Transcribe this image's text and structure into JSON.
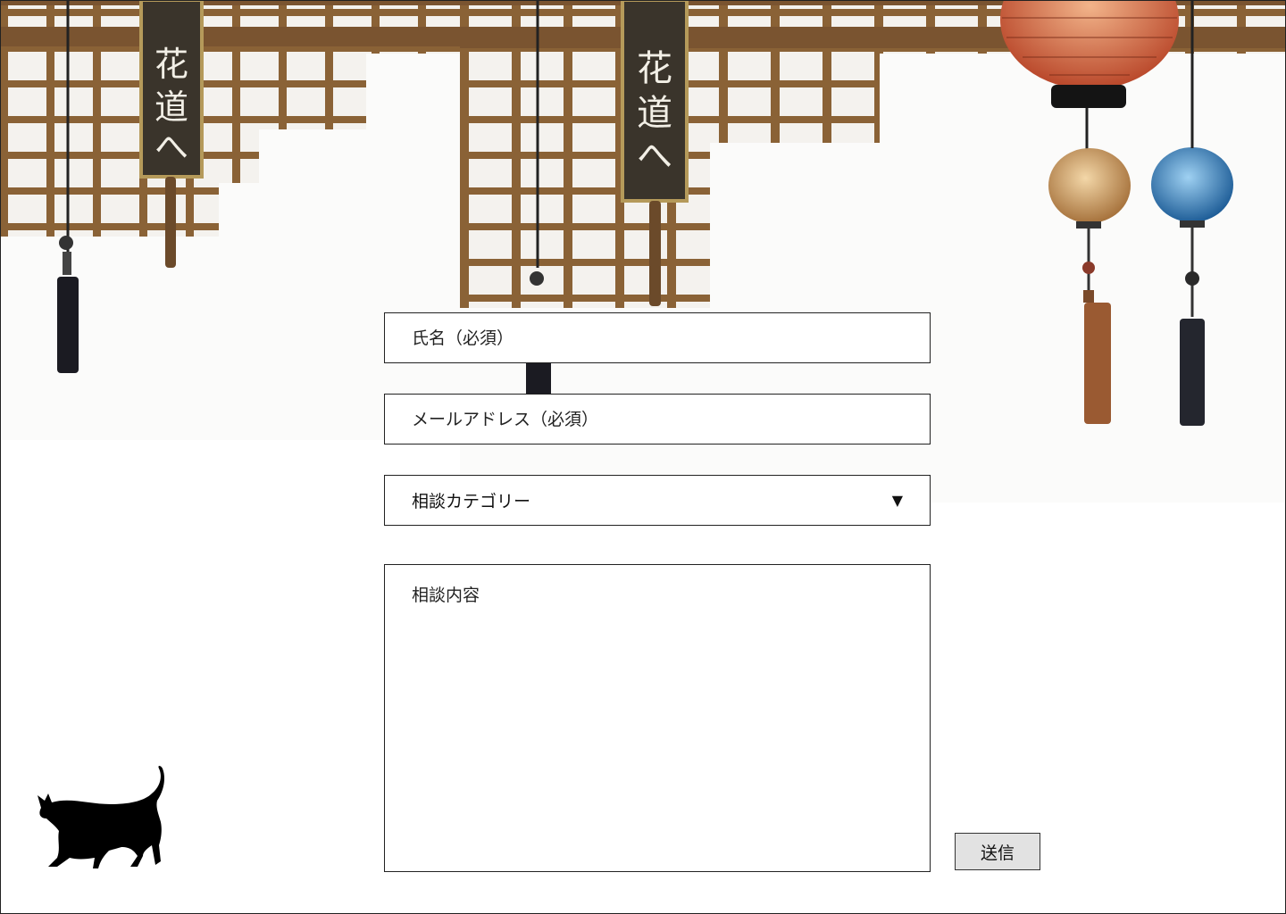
{
  "form": {
    "name_placeholder": "氏名（必須）",
    "email_placeholder": "メールアドレス（必須）",
    "category_label": "相談カテゴリー",
    "category_arrow": "▼",
    "message_placeholder": "相談内容",
    "submit_label": "送信"
  },
  "colors": {
    "border": "#222222",
    "submit_bg": "#e2e2e2",
    "lattice": "#8a6236"
  },
  "icons": {
    "logo": "black-cat-icon",
    "dropdown": "triangle-down-icon"
  }
}
